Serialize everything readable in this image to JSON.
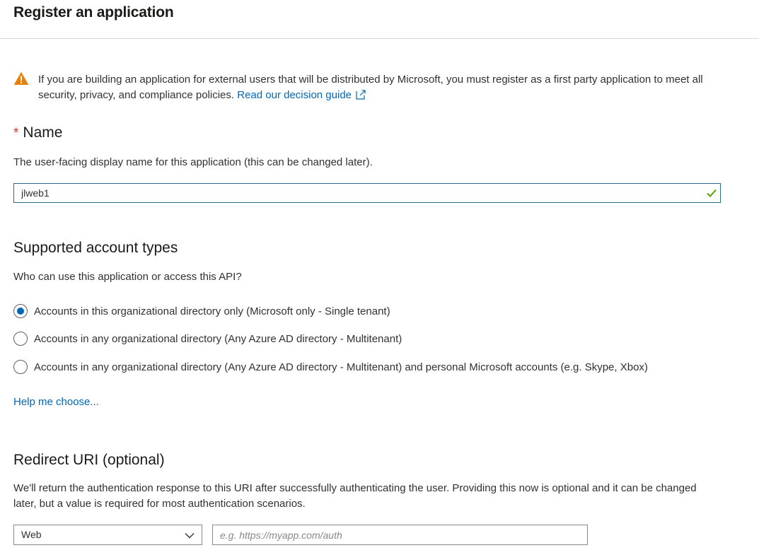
{
  "header": {
    "title": "Register an application"
  },
  "warning": {
    "text": "If you are building an application for external users that will be distributed by Microsoft, you must register as a first party application to meet all security, privacy, and compliance policies. ",
    "link_label": "Read our decision guide",
    "icon": "warning-triangle-icon",
    "color": "#e8810c"
  },
  "name_section": {
    "required_marker": "*",
    "title": "Name",
    "description": "The user-facing display name for this application (this can be changed later).",
    "value": "jlweb1",
    "valid_icon": "checkmark-icon"
  },
  "account_types": {
    "title": "Supported account types",
    "question": "Who can use this application or access this API?",
    "options": [
      {
        "label": "Accounts in this organizational directory only (Microsoft only - Single tenant)",
        "checked": true
      },
      {
        "label": "Accounts in any organizational directory (Any Azure AD directory - Multitenant)",
        "checked": false
      },
      {
        "label": "Accounts in any organizational directory (Any Azure AD directory - Multitenant) and personal Microsoft accounts (e.g. Skype, Xbox)",
        "checked": false
      }
    ],
    "help_link": "Help me choose..."
  },
  "redirect": {
    "title": "Redirect URI (optional)",
    "description": "We'll return the authentication response to this URI after successfully authenticating the user. Providing this now is optional and it can be changed later, but a value is required for most authentication scenarios.",
    "platform_value": "Web",
    "uri_placeholder": "e.g. https://myapp.com/auth",
    "uri_value": ""
  },
  "colors": {
    "accent": "#0067b8",
    "success": "#57a300",
    "required": "#d13438"
  }
}
